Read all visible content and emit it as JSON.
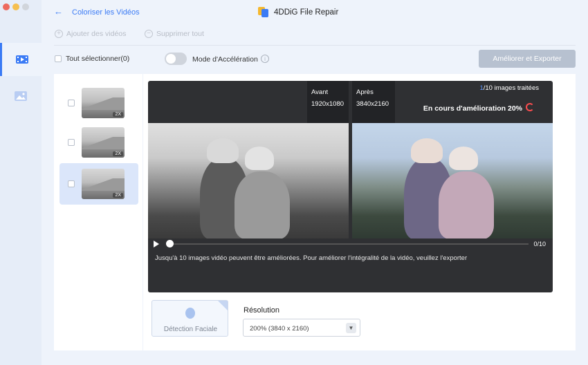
{
  "app": {
    "name": "4DDiG File Repair"
  },
  "header": {
    "back_icon": "arrow-left-icon",
    "title": "Coloriser les Vidéos"
  },
  "toolbar": {
    "add_label": "Ajouter des vidéos",
    "remove_label": "Supprimer tout",
    "select_all_label": "Tout sélectionner(0)",
    "acceleration_label": "Mode d'Accélération",
    "acceleration_on": false,
    "export_label": "Améliorer et Exporter"
  },
  "sidebar": {
    "items": [
      {
        "icon": "video-icon",
        "active": true
      },
      {
        "icon": "image-icon",
        "active": false
      }
    ]
  },
  "file_list": {
    "items": [
      {
        "badge": "2X",
        "selected": false
      },
      {
        "badge": "2X",
        "selected": false
      },
      {
        "badge": "2X",
        "selected": true
      }
    ]
  },
  "preview": {
    "before_label": "Avant",
    "before_res": "1920x1080",
    "after_label": "Après",
    "after_res": "3840x2160",
    "processed_current": "1",
    "processed_rest": "/10 images traitées",
    "status": "En cours d'amélioration 20%",
    "frame_counter": "0/10",
    "hint": "Jusqu'à 10 images vidéo peuvent être améliorées. Pour améliorer l'intégralité de la vidéo, veuillez l'exporter"
  },
  "options": {
    "face_detection_label": "Détection Faciale",
    "resolution_title": "Résolution",
    "resolution_value": "200% (3840 x 2160)"
  },
  "colors": {
    "accent": "#3b7bf5",
    "status_red": "#ff4d4f"
  }
}
